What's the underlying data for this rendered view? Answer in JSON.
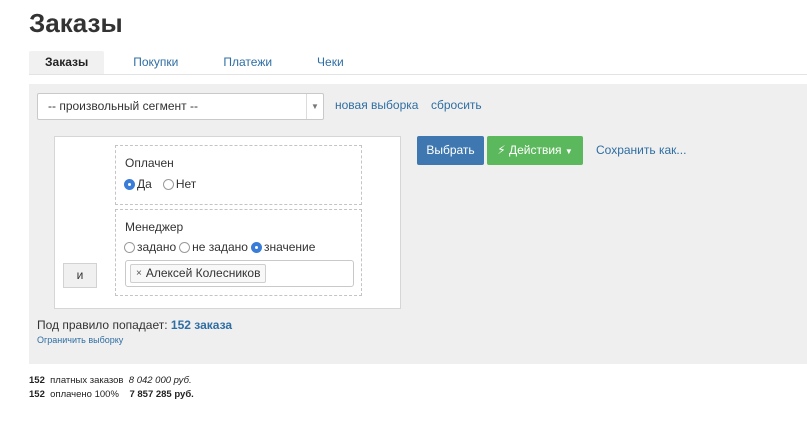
{
  "page": {
    "title": "Заказы"
  },
  "tabs": [
    {
      "label": "Заказы",
      "active": true
    },
    {
      "label": "Покупки",
      "active": false
    },
    {
      "label": "Платежи",
      "active": false
    },
    {
      "label": "Чеки",
      "active": false
    }
  ],
  "segment": {
    "selected": "-- произвольный сегмент --",
    "new_selection_link": "новая выборка",
    "reset_link": "сбросить"
  },
  "rules": {
    "and_button": "и",
    "paid": {
      "title": "Оплачен",
      "options": [
        {
          "label": "Да",
          "checked": true
        },
        {
          "label": "Нет",
          "checked": false
        }
      ]
    },
    "manager": {
      "title": "Менеджер",
      "options": [
        {
          "label": "задано",
          "checked": false
        },
        {
          "label": "не задано",
          "checked": false
        },
        {
          "label": "значение",
          "checked": true
        }
      ],
      "token_label": "Алексей Колесников",
      "token_remove": "×"
    }
  },
  "actions": {
    "select_button": "Выбрать",
    "actions_button": "Действия",
    "save_as_link": "Сохранить как..."
  },
  "result": {
    "prefix": "Под правило попадает:",
    "count": "152 заказа",
    "limit_link": "Ограничить выборку"
  },
  "stats": [
    {
      "count": "152",
      "label": "платных заказов",
      "amount": "8 042 000 руб.",
      "amount_style": "italic"
    },
    {
      "count": "152",
      "label": "оплачено 100%",
      "amount": "7 857 285 руб.",
      "amount_style": "bold"
    }
  ],
  "colors": {
    "link": "#2f6ea3",
    "primary_button": "#3f78b0",
    "success_button": "#5cb85c",
    "radio_checked": "#3a7dd8",
    "panel_bg": "#efefef"
  }
}
